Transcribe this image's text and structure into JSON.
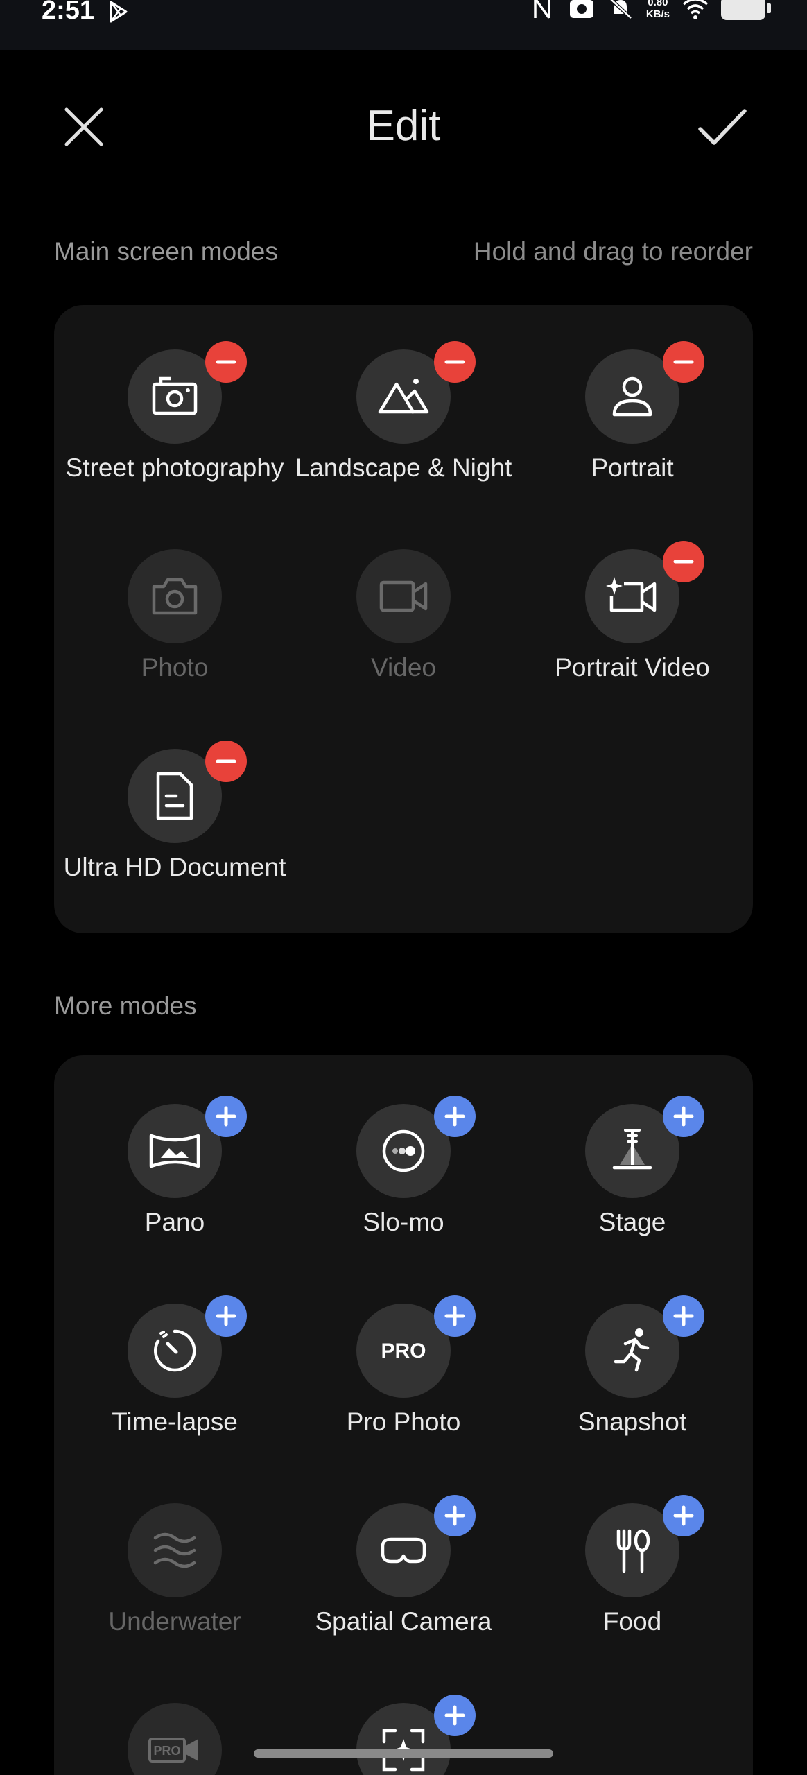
{
  "status_bar": {
    "time": "2:51",
    "speed_value": "0.80",
    "speed_unit": "KB/s",
    "icons": [
      "play-store-icon",
      "nfc-icon",
      "camera-icon",
      "mute-icon",
      "wifi-icon",
      "battery-icon"
    ]
  },
  "header": {
    "title": "Edit",
    "close_icon": "close-icon",
    "confirm_icon": "checkmark-icon"
  },
  "main_section": {
    "label": "Main screen modes",
    "hint": "Hold and drag to reorder",
    "modes": [
      {
        "label": "Street photography",
        "icon": "street-camera-icon",
        "badge": "remove",
        "enabled": true
      },
      {
        "label": "Landscape & Night",
        "icon": "mountain-icon",
        "badge": "remove",
        "enabled": true
      },
      {
        "label": "Portrait",
        "icon": "person-icon",
        "badge": "remove",
        "enabled": true
      },
      {
        "label": "Photo",
        "icon": "camera-icon",
        "badge": "",
        "enabled": false
      },
      {
        "label": "Video",
        "icon": "video-icon",
        "badge": "",
        "enabled": false
      },
      {
        "label": "Portrait Video",
        "icon": "sparkle-video-icon",
        "badge": "remove",
        "enabled": true
      },
      {
        "label": "Ultra HD Document",
        "icon": "document-icon",
        "badge": "remove",
        "enabled": true
      }
    ]
  },
  "more_section": {
    "label": "More modes",
    "modes": [
      {
        "label": "Pano",
        "icon": "panorama-icon",
        "badge": "add",
        "enabled": true
      },
      {
        "label": "Slo-mo",
        "icon": "slow-motion-icon",
        "badge": "add",
        "enabled": true
      },
      {
        "label": "Stage",
        "icon": "stage-spotlight-icon",
        "badge": "add",
        "enabled": true
      },
      {
        "label": "Time-lapse",
        "icon": "timer-icon",
        "badge": "add",
        "enabled": true
      },
      {
        "label": "Pro Photo",
        "icon": "pro-icon",
        "badge": "add",
        "enabled": true
      },
      {
        "label": "Snapshot",
        "icon": "running-person-icon",
        "badge": "add",
        "enabled": true
      },
      {
        "label": "Underwater",
        "icon": "waves-icon",
        "badge": "",
        "enabled": false
      },
      {
        "label": "Spatial Camera",
        "icon": "vr-goggles-icon",
        "badge": "add",
        "enabled": true
      },
      {
        "label": "Food",
        "icon": "fork-spoon-icon",
        "badge": "add",
        "enabled": true
      },
      {
        "label": "",
        "icon": "pro-video-icon",
        "badge": "",
        "enabled": false
      },
      {
        "label": "",
        "icon": "ai-frame-icon",
        "badge": "add",
        "enabled": true
      }
    ]
  },
  "colors": {
    "remove_badge": "#e8423a",
    "add_badge": "#5a86ea",
    "panel": "#141414",
    "icon_circle": "#333333"
  }
}
